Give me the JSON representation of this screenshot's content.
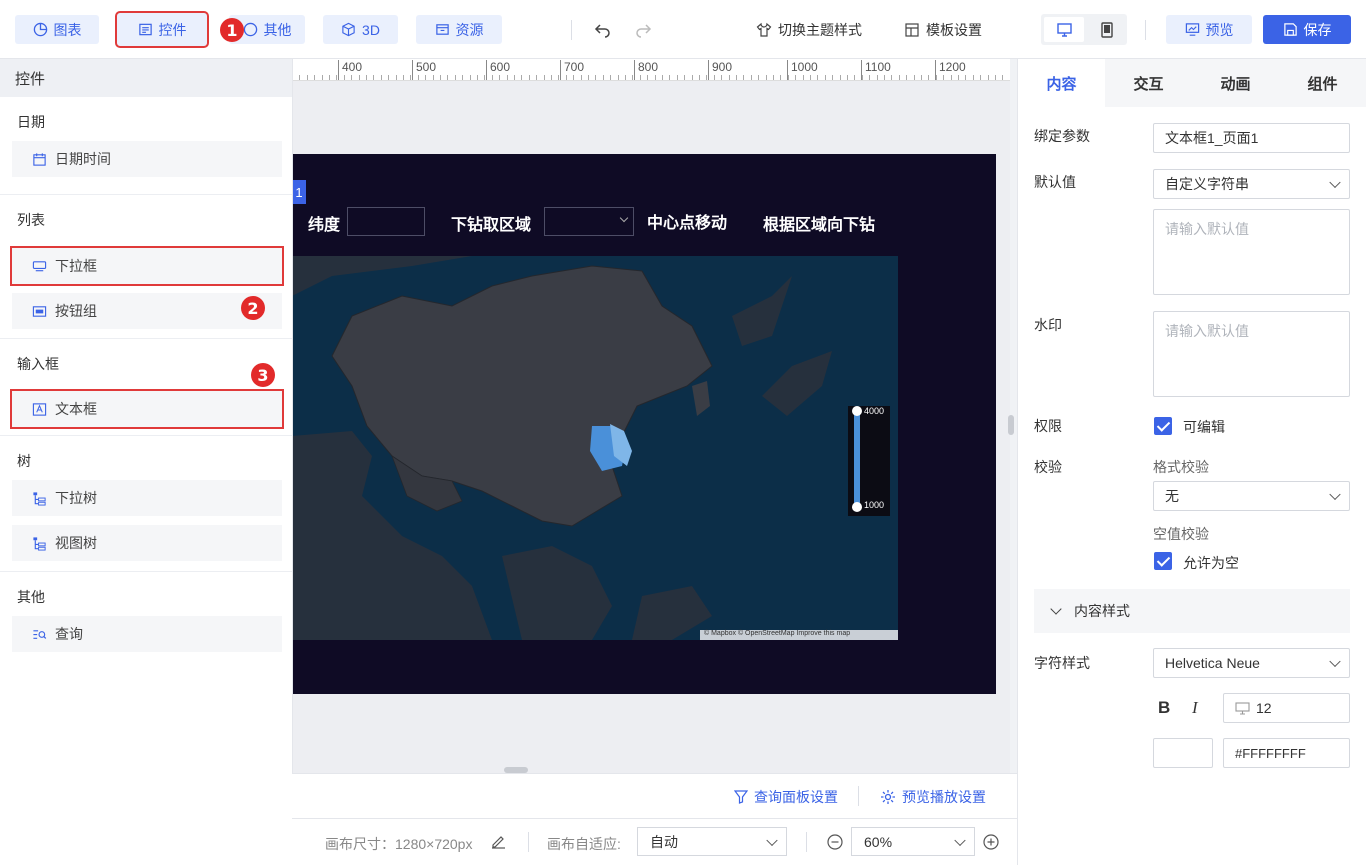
{
  "toolbar": {
    "chart": "图表",
    "widget": "控件",
    "other": "其他",
    "three_d": "3D",
    "resource": "资源",
    "theme": "切换主题样式",
    "template": "模板设置",
    "preview": "预览",
    "save": "保存"
  },
  "badges": [
    "1",
    "2",
    "3"
  ],
  "ruler": [
    "400",
    "500",
    "600",
    "700",
    "800",
    "900",
    "1000",
    "1100",
    "1200"
  ],
  "left_panel": {
    "title": "控件",
    "sections": [
      {
        "title": "日期",
        "items": [
          "日期时间"
        ]
      },
      {
        "title": "列表",
        "items": [
          "下拉框",
          "按钮组"
        ]
      },
      {
        "title": "输入框",
        "items": [
          "文本框"
        ]
      },
      {
        "title": "树",
        "items": [
          "下拉树",
          "视图树"
        ]
      },
      {
        "title": "其他",
        "items": [
          "查询"
        ]
      }
    ]
  },
  "dashboard": {
    "selection_index": "1",
    "latitude_label": "纬度",
    "drill_label": "下钻取区域",
    "center_move": "中心点移动",
    "drill_by_region": "根据区域向下钻",
    "legend_max": "4000",
    "legend_min": "1000",
    "attribution": "© Mapbox © OpenStreetMap Improve this map"
  },
  "right_panel": {
    "tabs": [
      "内容",
      "交互",
      "动画",
      "组件"
    ],
    "bind_param_label": "绑定参数",
    "bind_param_value": "文本框1_页面1",
    "default_label": "默认值",
    "default_select": "自定义字符串",
    "default_placeholder": "请输入默认值",
    "watermark_label": "水印",
    "watermark_placeholder": "请输入默认值",
    "permission_label": "权限",
    "editable_label": "可编辑",
    "validation_label": "校验",
    "format_validation": "格式校验",
    "format_value": "无",
    "null_validation": "空值校验",
    "allow_null": "允许为空",
    "content_style": "内容样式",
    "font_style_label": "字符样式",
    "font_value": "Helvetica Neue",
    "bold": "B",
    "italic": "I",
    "font_size": "12",
    "color_value": "#FFFFFFFF"
  },
  "bottom": {
    "query_panel": "查询面板设置",
    "preview_play": "预览播放设置",
    "canvas_size": "画布尺寸：1280×720px",
    "canvas_adapt": "画布自适应:",
    "adapt_value": "自动",
    "zoom": "60%"
  },
  "colors": {
    "accent": "#3b63e6",
    "badge": "#e22a2a",
    "dark_bg": "#0f0b25",
    "map_sea": "#0a2f4a",
    "map_land": "#3a3d45",
    "highlight": "#4a90d9"
  }
}
